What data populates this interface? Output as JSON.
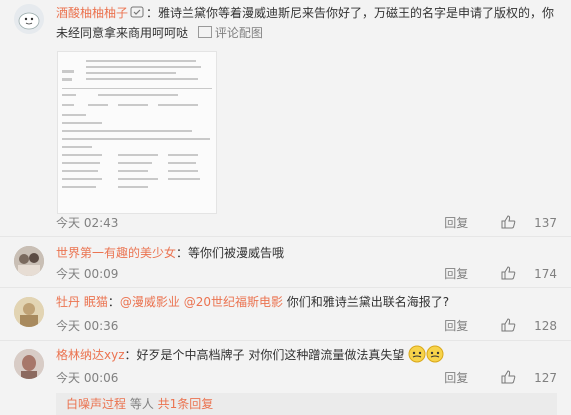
{
  "comments": [
    {
      "username": "酒酸柚柚柚子",
      "text": "：雅诗兰黛你等着漫威迪斯尼来告你好了，万磁王的名字是申请了版权的，你未经同意拿来商用呵呵哒",
      "picture_comment_label": "评论配图",
      "time": "今天 02:43",
      "reply_label": "回复",
      "likes": "137"
    },
    {
      "username": "世界第一有趣的美少女",
      "text": "：等你们被漫威告哦",
      "time": "今天 00:09",
      "reply_label": "回复",
      "likes": "174"
    },
    {
      "username": "牡丹 眠猫",
      "mention1": "@漫威影业",
      "mention2": "@20世纪福斯电影",
      "text_prefix": "：",
      "text_suffix": " 你们和雅诗兰黛出联名海报了?",
      "time": "今天 00:36",
      "reply_label": "回复",
      "likes": "128"
    },
    {
      "username": "格林纳达xyz",
      "text": "：好歹是个中高档牌子 对你们这种蹭流量做法真失望",
      "time": "今天 00:06",
      "reply_label": "回复",
      "likes": "127"
    }
  ],
  "footer": {
    "user": "白噪声过程",
    "text": " 等人 ",
    "link": "共1条回复"
  },
  "colors": {
    "username": "#eb7350",
    "meta": "#808080",
    "background": "#f3f3f3"
  }
}
